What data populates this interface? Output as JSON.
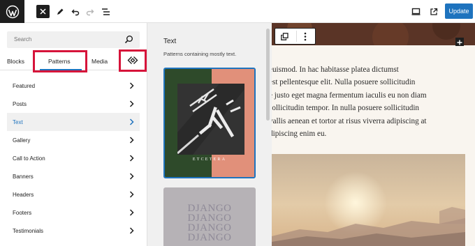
{
  "toolbar": {
    "update_label": "Update"
  },
  "inserter": {
    "search_placeholder": "Search",
    "tabs": [
      {
        "label": "Blocks"
      },
      {
        "label": "Patterns"
      },
      {
        "label": "Media"
      }
    ],
    "categories": [
      {
        "label": "Featured"
      },
      {
        "label": "Posts"
      },
      {
        "label": "Text"
      },
      {
        "label": "Gallery"
      },
      {
        "label": "Call to Action"
      },
      {
        "label": "Banners"
      },
      {
        "label": "Headers"
      },
      {
        "label": "Footers"
      },
      {
        "label": "Testimonials"
      }
    ],
    "active_category_index": 2
  },
  "patterns": {
    "title": "Text",
    "description": "Patterns containing mostly text.",
    "card1_caption": "ETCETERA",
    "card2_lines": [
      "DJANGO",
      "DJANGO",
      "DJANGO",
      "DJANGO"
    ]
  },
  "canvas": {
    "lines": [
      "euismod. In hac habitasse platea dictumst",
      "est pellentesque elit. Nulla posuere sollicitudin",
      "e justo eget magna fermentum iaculis eu non diam",
      "sollicitudin tempor. In nulla posuere sollicitudin",
      "vallis aenean et tortor at risus viverra adipiscing at",
      "dipiscing enim eu."
    ]
  },
  "colors": {
    "accent": "#1e73be",
    "highlight": "#d6143a",
    "dark": "#1e1e1e"
  }
}
